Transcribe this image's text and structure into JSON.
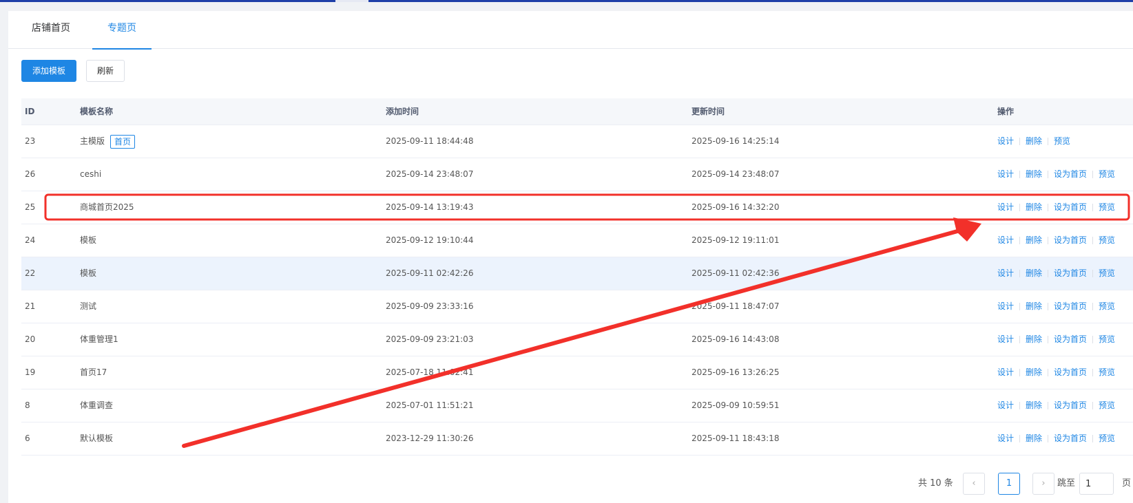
{
  "tabs": [
    {
      "label": "店铺首页"
    },
    {
      "label": "专题页"
    }
  ],
  "toolbar": {
    "add_label": "添加模板",
    "refresh_label": "刷新"
  },
  "table": {
    "headers": {
      "id": "ID",
      "name": "模板名称",
      "added": "添加时间",
      "updated": "更新时间",
      "ops": "操作"
    },
    "rows": [
      {
        "id": "23",
        "name": "主模版",
        "tag": "首页",
        "added": "2025-09-11 18:44:48",
        "updated": "2025-09-16 14:25:14"
      },
      {
        "id": "26",
        "name": "ceshi",
        "added": "2025-09-14 23:48:07",
        "updated": "2025-09-14 23:48:07"
      },
      {
        "id": "25",
        "name": "商城首页2025",
        "added": "2025-09-14 13:19:43",
        "updated": "2025-09-16 14:32:20"
      },
      {
        "id": "24",
        "name": "模板",
        "added": "2025-09-12 19:10:44",
        "updated": "2025-09-12 19:11:01"
      },
      {
        "id": "22",
        "name": "模板",
        "added": "2025-09-11 02:42:26",
        "updated": "2025-09-11 02:42:36"
      },
      {
        "id": "21",
        "name": "测试",
        "added": "2025-09-09 23:33:16",
        "updated": "2025-09-11 18:47:07"
      },
      {
        "id": "20",
        "name": "体重管理1",
        "added": "2025-09-09 23:21:03",
        "updated": "2025-09-16 14:43:08"
      },
      {
        "id": "19",
        "name": "首页17",
        "added": "2025-07-18 11:02:41",
        "updated": "2025-09-16 13:26:25"
      },
      {
        "id": "8",
        "name": "体重调查",
        "added": "2025-07-01 11:51:21",
        "updated": "2025-09-09 10:59:51"
      },
      {
        "id": "6",
        "name": "默认模板",
        "added": "2023-12-29 11:30:26",
        "updated": "2025-09-11 18:43:18"
      }
    ],
    "ops": {
      "design": "设计",
      "delete": "删除",
      "set_home": "设为首页",
      "preview": "预览"
    }
  },
  "pagination": {
    "total": "共 10 条",
    "current": "1",
    "jump_label": "跳至",
    "jump_value": "1",
    "jump_suffix": "页"
  },
  "colors": {
    "accent": "#1e86e4",
    "annotation": "#f2302a"
  }
}
